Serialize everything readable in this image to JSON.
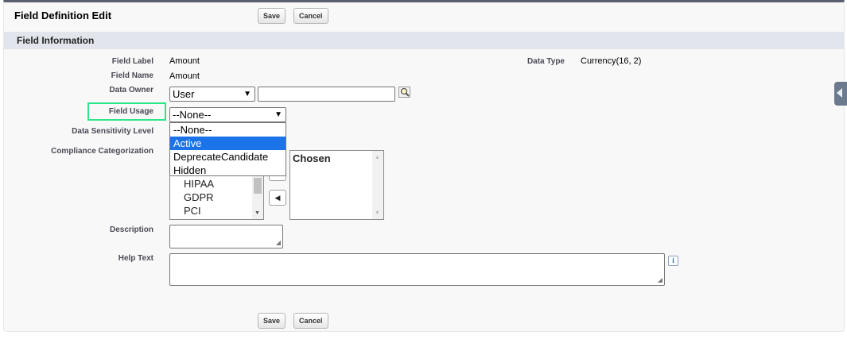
{
  "header": {
    "title": "Field Definition Edit",
    "save_label": "Save",
    "cancel_label": "Cancel"
  },
  "section": {
    "title": "Field Information"
  },
  "fields": {
    "field_label": {
      "label": "Field Label",
      "value": "Amount"
    },
    "field_name": {
      "label": "Field Name",
      "value": "Amount"
    },
    "data_owner": {
      "label": "Data Owner",
      "selected": "User",
      "text_value": ""
    },
    "field_usage": {
      "label": "Field Usage",
      "selected": "--None--"
    },
    "data_sensitivity": {
      "label": "Data Sensitivity Level"
    },
    "compliance": {
      "label": "Compliance Categorization",
      "available": [
        "HIPAA",
        "GDPR",
        "PCI"
      ],
      "chosen_header": "Chosen"
    },
    "description": {
      "label": "Description",
      "value": ""
    },
    "help_text": {
      "label": "Help Text",
      "value": ""
    },
    "data_type": {
      "label": "Data Type",
      "value": "Currency(16, 2)"
    }
  },
  "field_usage_options": [
    "--None--",
    "Active",
    "DeprecateCandidate",
    "Hidden"
  ],
  "field_usage_highlighted": "Active",
  "footer": {
    "save_label": "Save",
    "cancel_label": "Cancel"
  },
  "icons": {
    "lookup": "magnifier-lookup-icon",
    "info": "info-icon",
    "remove": "arrow-left-icon",
    "sidebar": "collapse-arrow-icon"
  },
  "colors": {
    "highlight_box": "#2de68a",
    "selected_option": "#1a73e8",
    "section_header": "#e2e5ec"
  }
}
